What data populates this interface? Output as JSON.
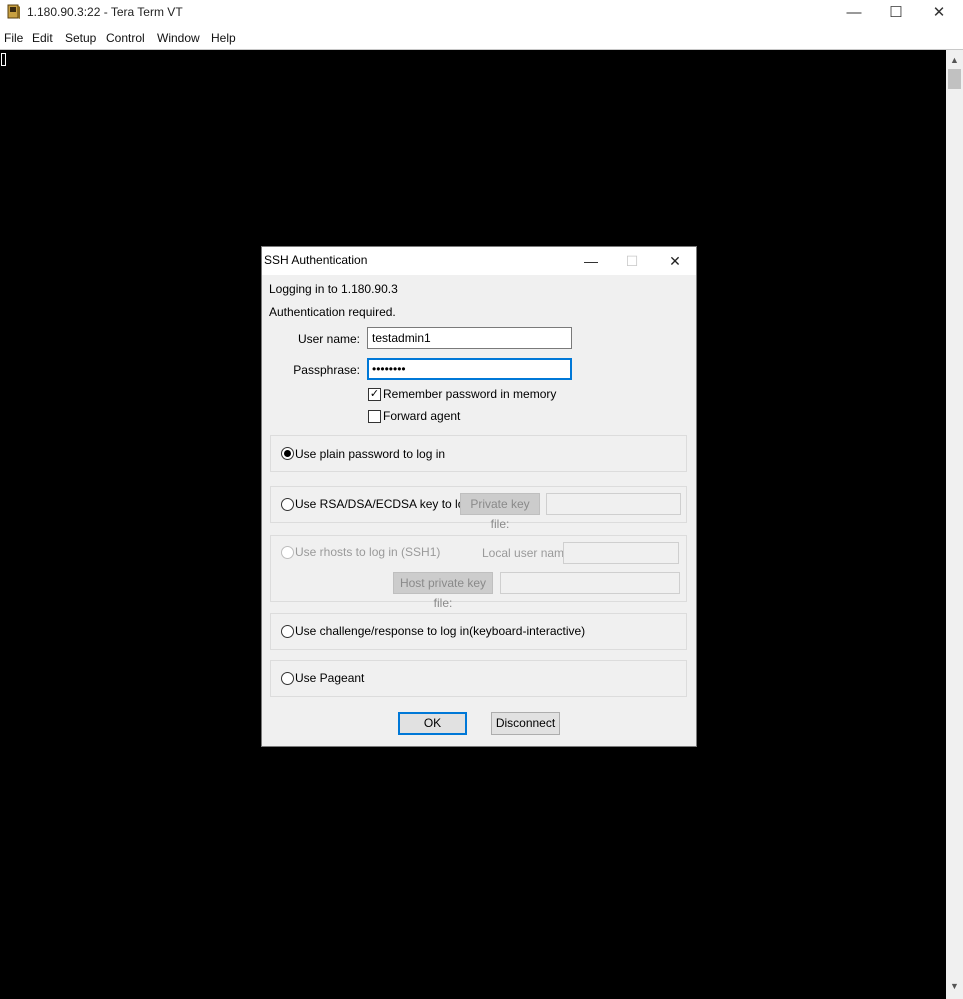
{
  "window": {
    "title": "1.180.90.3:22 - Tera Term VT",
    "icon": "teraterm-icon",
    "controls": {
      "minimize": "—",
      "maximize": "☐",
      "close": "✕"
    }
  },
  "menu": [
    "File",
    "Edit",
    "Setup",
    "Control",
    "Window",
    "Help"
  ],
  "scrollbar": {
    "up": "▲",
    "down": "▼"
  },
  "dialog": {
    "title": "SSH Authentication",
    "controls": {
      "minimize": "—",
      "maximize": "☐",
      "close": "✕"
    },
    "logging_in": "Logging in to 1.180.90.3",
    "auth_required": "Authentication required.",
    "username_label": "User name:",
    "username_value": "testadmin1",
    "passphrase_label": "Passphrase:",
    "passphrase_value": "••••••••",
    "remember_password": {
      "label": "Remember password in memory",
      "checked": true,
      "mark": "✓"
    },
    "forward_agent": {
      "label": "Forward agent",
      "checked": false
    },
    "methods": {
      "plain": {
        "label": "Use plain password to log in",
        "selected": true
      },
      "rsa": {
        "label": "Use RSA/DSA/ECDSA key to log in",
        "selected": false,
        "key_button": "Private key file:",
        "key_value": ""
      },
      "rhosts": {
        "label": "Use rhosts to log in (SSH1)",
        "selected": false,
        "enabled": false,
        "local_user_label": "Local user name:",
        "local_user_value": "",
        "host_key_button": "Host private key file:",
        "host_key_value": ""
      },
      "challenge": {
        "label": "Use challenge/response to log in(keyboard-interactive)",
        "selected": false
      },
      "pageant": {
        "label": "Use Pageant",
        "selected": false
      }
    },
    "ok_button": "OK",
    "disconnect_button": "Disconnect"
  }
}
